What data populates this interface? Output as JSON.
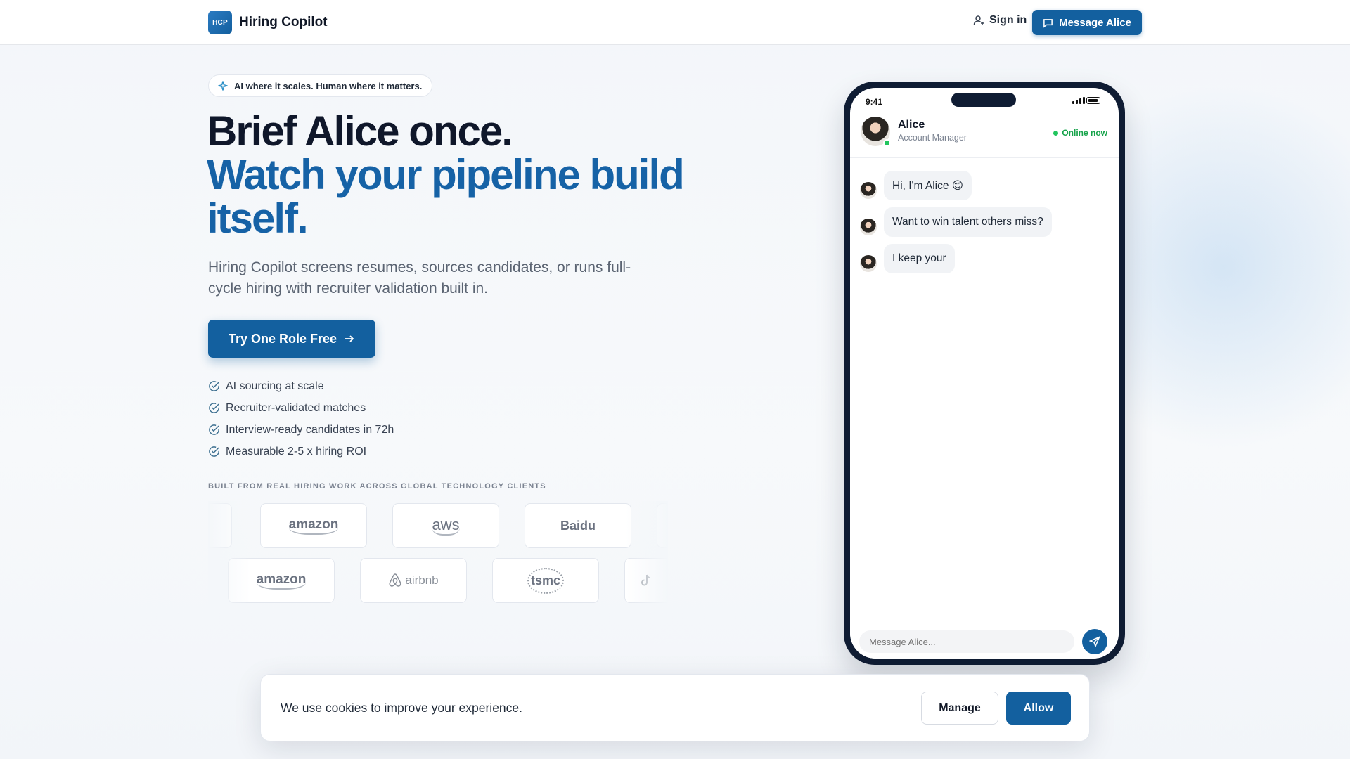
{
  "header": {
    "logo_mark": "HCP",
    "brand": "Hiring Copilot",
    "signin_label": "Sign in",
    "message_label": "Message Alice"
  },
  "hero": {
    "pill": "AI where it scales. Human where it matters.",
    "headline_1": "Brief Alice once.",
    "headline_2": "Watch your pipeline build itself.",
    "subtitle": "Hiring Copilot screens resumes, sources candidates, or runs full-cycle hiring with recruiter validation built in.",
    "cta_label": "Try One Role Free",
    "features": [
      "AI sourcing at scale",
      "Recruiter-validated matches",
      "Interview-ready candidates in 72h",
      "Measurable 2-5 x hiring ROI"
    ],
    "clients_label": "BUILT FROM REAL HIRING WORK ACROSS GLOBAL TECHNOLOGY CLIENTS",
    "client_logos_row1": [
      "amazon",
      "aws",
      "Baidu"
    ],
    "client_logos_row2": [
      "amazon",
      "airbnb",
      "tsmc"
    ]
  },
  "phone": {
    "time": "9:41",
    "agent_name": "Alice",
    "agent_role": "Account Manager",
    "status": "Online now",
    "messages": [
      "Hi, I'm Alice 😊",
      "Want to win talent others miss?",
      "I keep your"
    ],
    "composer_placeholder": "Message Alice..."
  },
  "cookie": {
    "text": "We use cookies to improve your experience.",
    "manage_label": "Manage",
    "allow_label": "Allow"
  },
  "colors": {
    "primary": "#13609f",
    "headline_dark": "#0f172a",
    "headline_blue": "#1662a6",
    "online": "#22c55e"
  }
}
